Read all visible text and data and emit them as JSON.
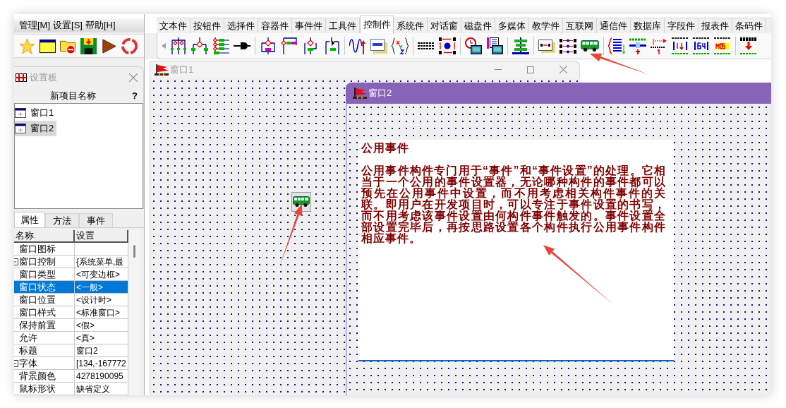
{
  "menu_bar": {
    "items": [
      "管理[M]",
      "设置[S]",
      "帮助[H]"
    ]
  },
  "settings_panel": {
    "title": "设置板",
    "header": "新项目名称",
    "help": "?",
    "items": [
      {
        "label": "窗口1",
        "selected": false
      },
      {
        "label": "窗口2",
        "selected": true
      }
    ]
  },
  "property_tabs": [
    {
      "label": "属性",
      "selected": true
    },
    {
      "label": "方法",
      "selected": false
    },
    {
      "label": "事件",
      "selected": false
    }
  ],
  "property_grid": {
    "columns": [
      "名称",
      "设置"
    ],
    "rows": [
      {
        "name": "窗口图标",
        "expandable": false,
        "selected": false
      },
      {
        "name": "窗口控制",
        "value": "{系统菜单,最",
        "expandable": true,
        "selected": false
      },
      {
        "name": "窗口类型",
        "value": "<可变边框>",
        "expandable": false,
        "selected": false
      },
      {
        "name": "窗口状态",
        "value": "<一般>",
        "expandable": false,
        "selected": true
      },
      {
        "name": "窗口位置",
        "value": "<设计时>",
        "expandable": false,
        "selected": false
      },
      {
        "name": "窗口样式",
        "value": "<标准窗口>",
        "expandable": false,
        "selected": false
      },
      {
        "name": "保持前置",
        "value": "<假>",
        "expandable": false,
        "selected": false
      },
      {
        "name": "允许",
        "value": "<真>",
        "expandable": false,
        "selected": false
      },
      {
        "name": "标题",
        "value": "窗口2",
        "expandable": false,
        "selected": false
      },
      {
        "name": "字体",
        "value": "[134,-167772",
        "expandable": true,
        "selected": false
      },
      {
        "name": "背景颜色",
        "value": "4278190095",
        "expandable": false,
        "selected": false
      },
      {
        "name": "鼠标形状",
        "value": "缺省定义",
        "expandable": false,
        "selected": false
      }
    ]
  },
  "component_tabs": [
    {
      "label": "文本件",
      "selected": false
    },
    {
      "label": "按钮件",
      "selected": false
    },
    {
      "label": "选择件",
      "selected": false
    },
    {
      "label": "容器件",
      "selected": false
    },
    {
      "label": "事件件",
      "selected": false
    },
    {
      "label": "工具件",
      "selected": false
    },
    {
      "label": "控制件",
      "selected": true
    },
    {
      "label": "系统件",
      "selected": false
    },
    {
      "label": "对话窗",
      "selected": false
    },
    {
      "label": "磁盘件",
      "selected": false
    },
    {
      "label": "多媒体",
      "selected": false
    },
    {
      "label": "教学件",
      "selected": false
    },
    {
      "label": "互联网",
      "selected": false
    },
    {
      "label": "通信件",
      "selected": false
    },
    {
      "label": "数据库",
      "selected": false
    },
    {
      "label": "字段件",
      "selected": false
    },
    {
      "label": "报表件",
      "selected": false
    },
    {
      "label": "条码件",
      "selected": false
    }
  ],
  "windows": [
    {
      "title": "窗口1",
      "active": false
    },
    {
      "title": "窗口2",
      "active": true,
      "text_box": {
        "title": "公用事件",
        "body": "公用事件构件专门用于“事件”和“事件设置”的处理。它相当于一个公用的事件设置器，无论哪种构件的事件都可以预先在公用事件中设置，而不用考虑相关构件事件的关联。即用户在开发项目时，可以专注于事件设置的书写，而不用考虑该事件设置由何构件事件触发的。事件设置全部设置完毕后，再按思路设置各个构件执行公用事件构件相应事件。"
      }
    }
  ]
}
